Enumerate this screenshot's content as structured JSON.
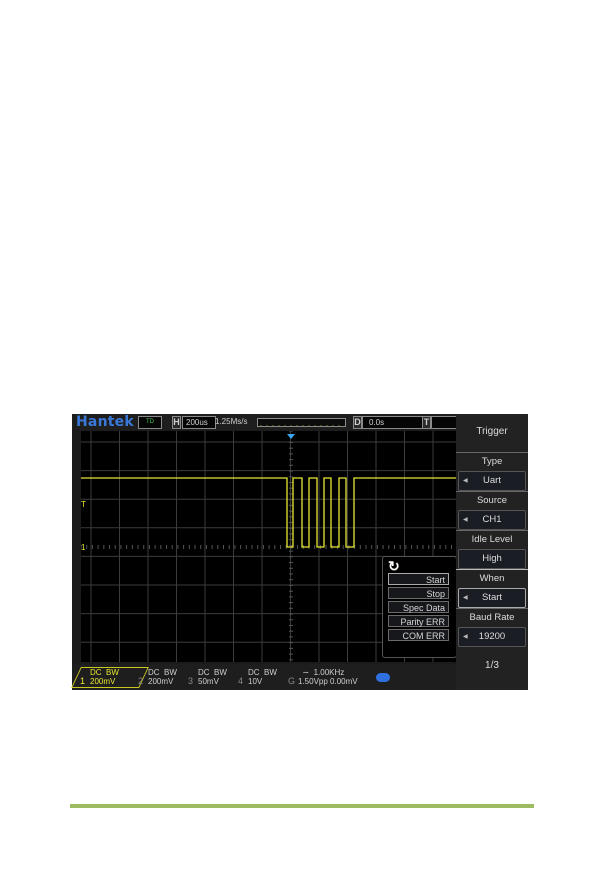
{
  "scope": {
    "brand": "Hantek",
    "run_status": "TD",
    "horizontal": {
      "label": "H",
      "timebase": "200us"
    },
    "sample_rate": "1.25Ms/s",
    "delay": {
      "label": "D",
      "value": "0.0s"
    },
    "trigger_label": "T",
    "side_menu": {
      "title": "Trigger",
      "items": [
        {
          "label": "Type",
          "value": "Uart"
        },
        {
          "label": "Source",
          "value": "CH1"
        },
        {
          "label": "Idle Level",
          "value": "High"
        },
        {
          "label": "When",
          "value": "Start"
        },
        {
          "label": "Baud Rate",
          "value": "19200"
        }
      ],
      "page": "1/3"
    },
    "when_popup": {
      "options": [
        "Start",
        "Stop",
        "Spec Data",
        "Parity ERR",
        "COM ERR"
      ],
      "selected": "Start"
    },
    "channels": [
      {
        "num": "1",
        "coupling": "DC",
        "bw": "BW",
        "scale": "200mV",
        "active": true
      },
      {
        "num": "2",
        "coupling": "DC",
        "bw": "BW",
        "scale": "200mV",
        "active": false
      },
      {
        "num": "3",
        "coupling": "DC",
        "bw": "BW",
        "scale": "50mV",
        "active": false
      },
      {
        "num": "4",
        "coupling": "DC",
        "bw": "BW",
        "scale": "10V",
        "active": false
      }
    ],
    "generator": {
      "label": "G",
      "freq": "1.00KHz",
      "amplitude": "1.50Vpp",
      "offset": "0.00mV"
    },
    "markers": {
      "trigger_level": "T",
      "ch1_ground": "1"
    },
    "colors": {
      "trace": "#e8e832",
      "accent": "#3a78d8",
      "footer_line": "#9cbb62"
    }
  }
}
